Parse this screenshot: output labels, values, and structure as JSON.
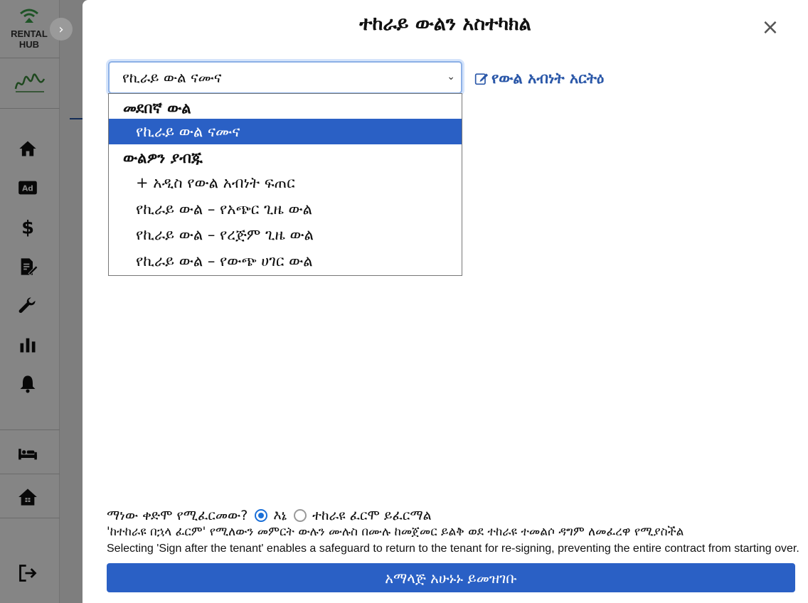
{
  "brand": {
    "line1": "RENTAL",
    "line2": "HUB",
    "icon": "wifi-house-logo"
  },
  "sidebar": {
    "collapse_icon": "chevron-right-icon",
    "items": [
      {
        "icon": "home-icon"
      },
      {
        "icon": "ad-icon",
        "label": "Ad"
      },
      {
        "icon": "dollar-icon",
        "label": "$"
      },
      {
        "icon": "contract-edit-icon"
      },
      {
        "icon": "wrench-icon"
      },
      {
        "icon": "bar-chart-icon"
      },
      {
        "icon": "bell-icon"
      },
      {
        "icon": "bed-icon"
      },
      {
        "icon": "house-icon"
      },
      {
        "icon": "logout-icon"
      }
    ]
  },
  "modal": {
    "title": "ተከራይ ውልን አስተካክል",
    "close_label": "×",
    "select": {
      "value": "የኪራይ ውል ናሙና"
    },
    "edit_link": "የውል አብነት አርትዕ",
    "dropdown": {
      "group1": "መደበኛ ውል",
      "group1_options": [
        "የኪራይ ውል ናሙና"
      ],
      "group2": "ውልዎን ያብጁ",
      "group2_options": [
        "+ አዲስ የውል አብነት ፍጠር",
        "የኪራይ ውል – የአጭር ጊዜ ውል",
        "የኪራይ ውል – የረጅም ጊዜ ውል",
        "የኪራይ ውል – የውጭ ሀገር ውል"
      ]
    },
    "signer": {
      "question": "ማነው ቀድሞ የሚፈርመው?",
      "option_me": "እኔ",
      "option_tenant": "ተከራዩ ፈርሞ ይፈርማል"
    },
    "hint_am": "'ከተከራዩ በኋላ ፈርም' የሚለውን መምርት ውሉን ሙሉስ በሙሉ ከመጀመር ይልቅ ወደ ተከራዩ ተመልሶ ዳግም ለመፈረዋ የሚያስችል",
    "hint_en": "Selecting 'Sign after the tenant' enables a safeguard to return to the tenant for re-signing, preventing the entire contract from starting over.",
    "submit": "አማላጅ አሁኑኑ ይመዝገቡ"
  },
  "colors": {
    "accent": "#2a60c5",
    "link": "#2a57a8",
    "radio": "#1a6fd8"
  }
}
